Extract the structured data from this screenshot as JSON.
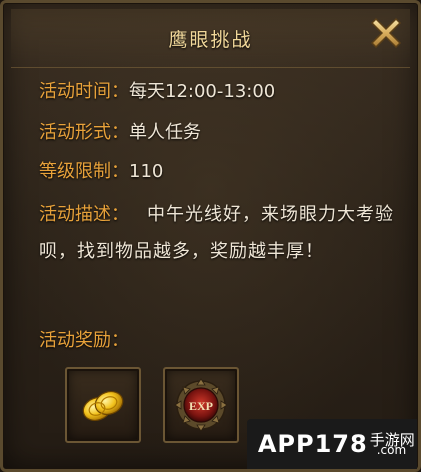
{
  "dialog": {
    "title": "鹰眼挑战"
  },
  "info": {
    "time_label": "活动时间：",
    "time_value": "每天12:00-13:00",
    "form_label": "活动形式：",
    "form_value": "单人任务",
    "level_label": "等级限制：",
    "level_value": "110",
    "desc_label": "活动描述：",
    "desc_value": "中午光线好，来场眼力大考验呗，找到物品越多，奖励越丰厚！"
  },
  "rewards": {
    "label": "活动奖励：",
    "items": [
      {
        "icon": "gold-coins-icon"
      },
      {
        "icon": "exp-orb-icon",
        "text": "EXP"
      }
    ]
  },
  "watermark": {
    "main": "APP178",
    "sub": "手游网",
    "domain": ".com"
  },
  "colors": {
    "label": "#e8a23a",
    "value": "#efe6d6",
    "title": "#f1d89a"
  }
}
